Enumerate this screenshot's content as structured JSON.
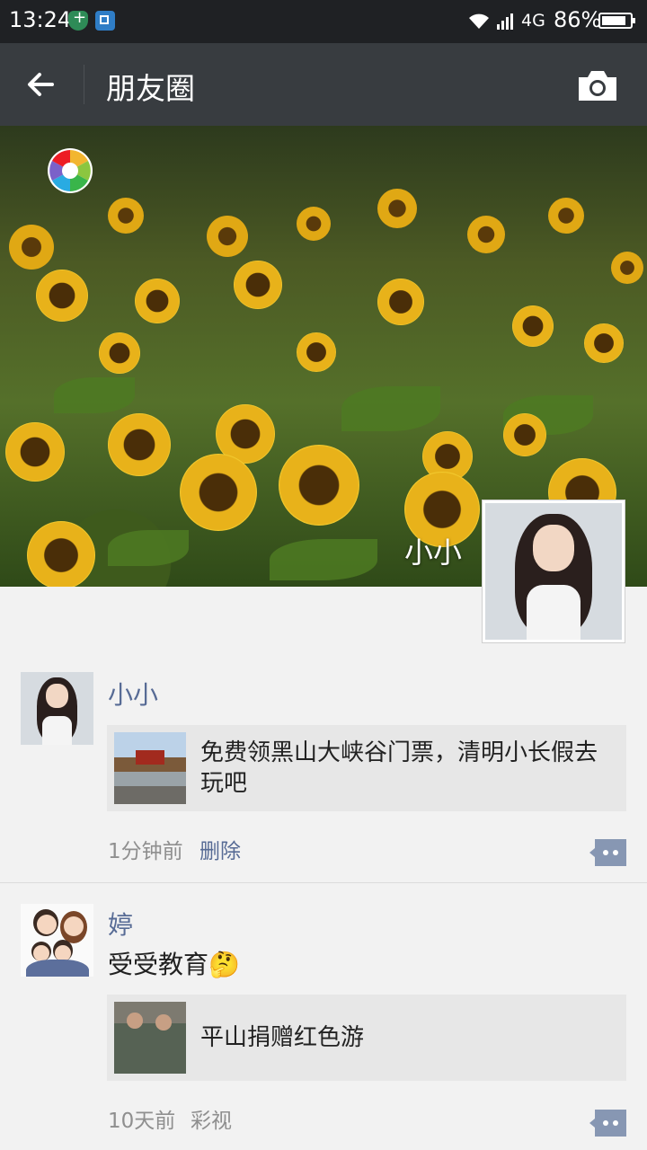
{
  "status_bar": {
    "time": "13:24",
    "network": "4G",
    "battery_percent": "86%",
    "battery_level": 0.86,
    "icons": [
      "shield-icon",
      "screenshot-icon",
      "wifi-icon",
      "signal-icon",
      "battery-icon"
    ]
  },
  "header": {
    "title": "朋友圈",
    "back_icon": "arrow-left-icon",
    "camera_icon": "camera-icon",
    "background_color": "#383c40"
  },
  "cover": {
    "user_name": "小小",
    "logo_icon": "aperture-logo-icon"
  },
  "feed": [
    {
      "name": "小小",
      "text": "",
      "link_title": "免费领黑山大峡谷门票，清明小长假去玩吧",
      "time": "1分钟前",
      "action": "删除",
      "source": ""
    },
    {
      "name": "婷",
      "text": "受受教育🤔",
      "link_title": "平山捐赠红色游",
      "time": "10天前",
      "action": "",
      "source": "彩视"
    }
  ],
  "colors": {
    "name_blue": "#576b95",
    "meta_gray": "#8f8f8f",
    "feed_bg": "#f2f2f2",
    "card_bg": "#e7e7e7"
  }
}
